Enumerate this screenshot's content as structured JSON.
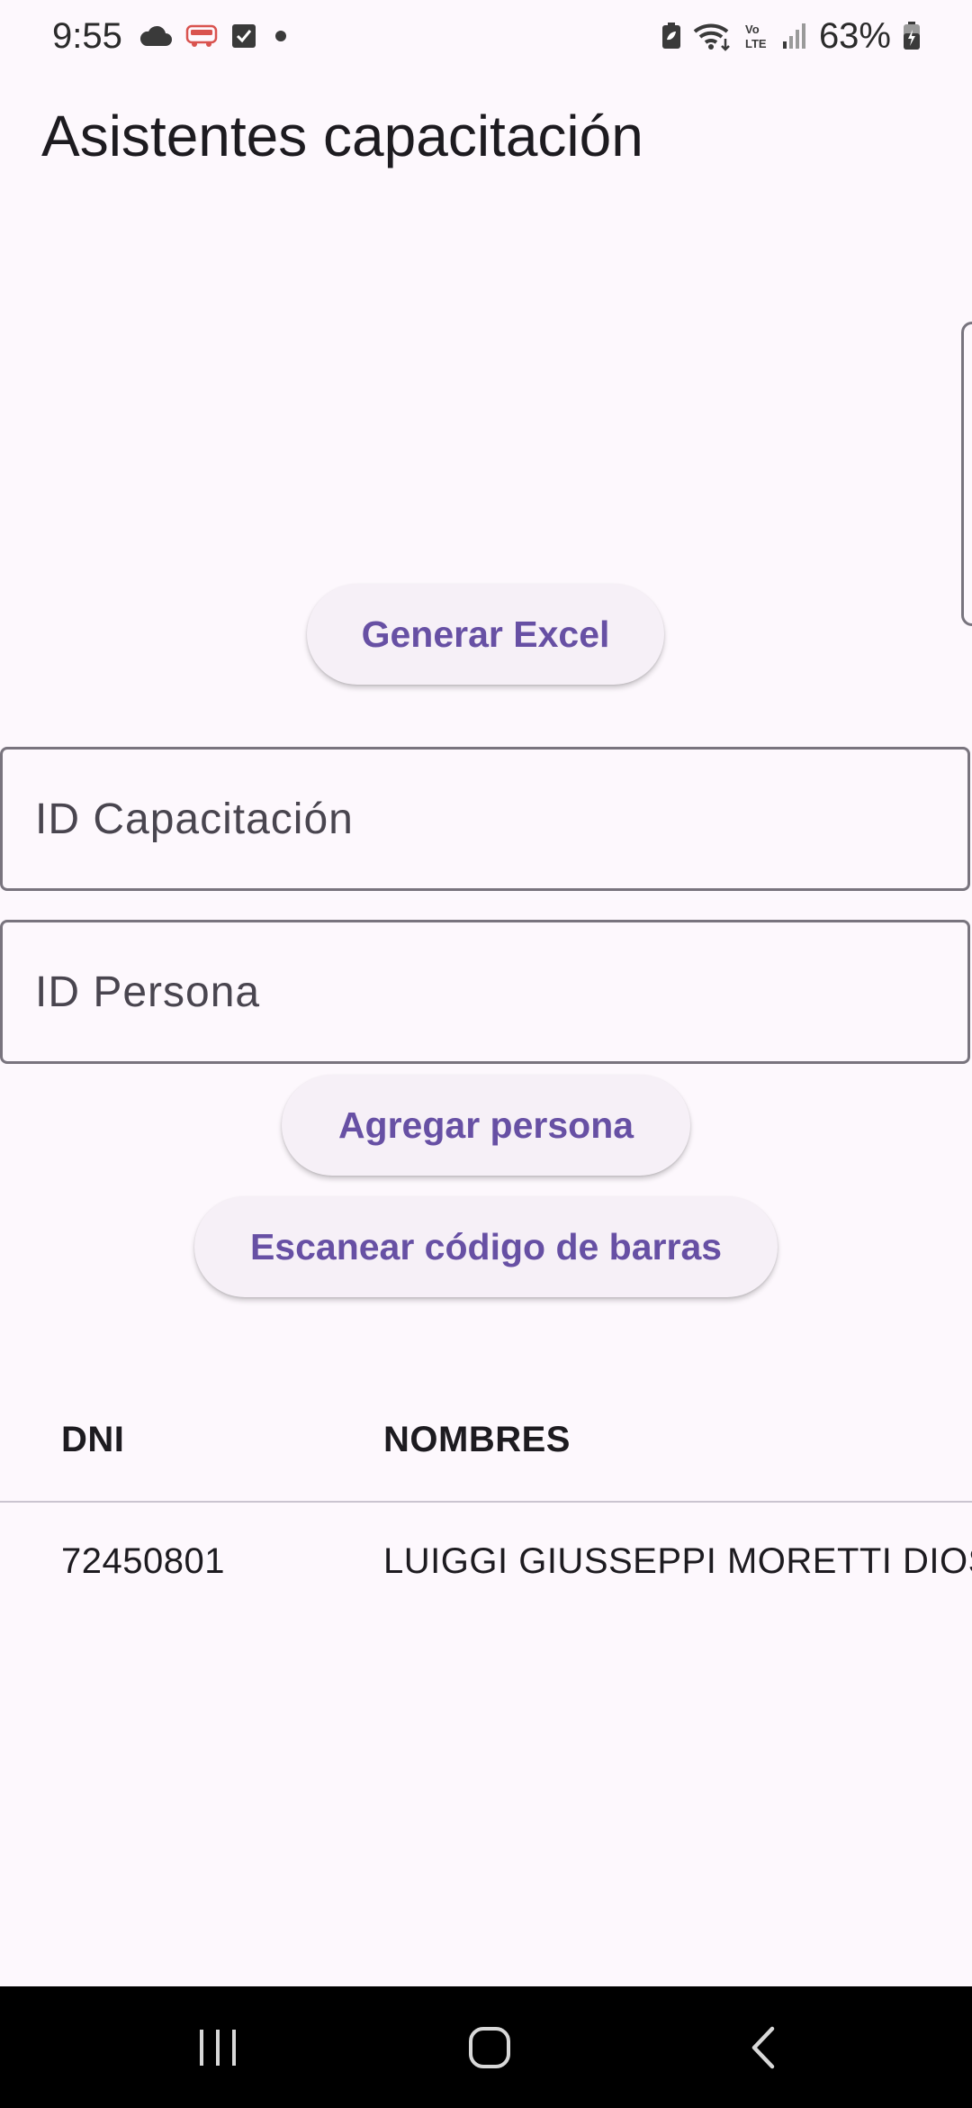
{
  "status_bar": {
    "time": "9:55",
    "battery_percent": "63%",
    "left_icons": [
      "cloud-icon",
      "bus-app-icon",
      "checkbox-app-icon",
      "dot-icon"
    ],
    "right_icons": [
      "battery-saver-icon",
      "wifi-icon",
      "volte-icon",
      "signal-icon",
      "battery-icon"
    ]
  },
  "app": {
    "title": "Asistentes capacitación"
  },
  "actions": {
    "generate_excel_label": "Generar Excel",
    "add_person_label": "Agregar persona",
    "scan_barcode_label": "Escanear código de barras"
  },
  "form": {
    "training_id": {
      "placeholder": "ID Capacitación",
      "value": ""
    },
    "person_id": {
      "placeholder": "ID Persona",
      "value": ""
    }
  },
  "table": {
    "columns": [
      "DNI",
      "NOMBRES"
    ],
    "rows": [
      {
        "dni": "72450801",
        "nombres": "LUIGGI GIUSSEPPI MORETTI DIOS"
      }
    ]
  },
  "nav_bar": {
    "buttons": [
      "recents-icon",
      "home-icon",
      "back-icon"
    ]
  },
  "colors": {
    "background": "#fdf8fd",
    "accent": "#6750a4",
    "button_surface": "#f6f0f7",
    "outline": "#79747e",
    "nav_bar": "#000000"
  }
}
